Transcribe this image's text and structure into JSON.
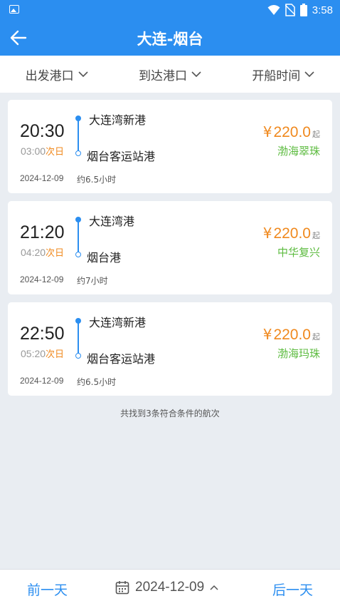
{
  "status_bar": {
    "time": "3:58"
  },
  "header": {
    "title": "大连-烟台"
  },
  "filters": [
    {
      "label": "出发港口"
    },
    {
      "label": "到达港口"
    },
    {
      "label": "开船时间"
    }
  ],
  "voyages": [
    {
      "departure_time": "20:30",
      "arrival_time": "03:00",
      "arrival_day_note": "次日",
      "departure_port": "大连湾新港",
      "arrival_port": "烟台客运站港",
      "price_symbol": "¥",
      "price": "220.0",
      "price_unit": "起",
      "ship_name": "渤海翠珠",
      "date": "2024-12-09",
      "duration": "约6.5小时"
    },
    {
      "departure_time": "21:20",
      "arrival_time": "04:20",
      "arrival_day_note": "次日",
      "departure_port": "大连湾港",
      "arrival_port": "烟台港",
      "price_symbol": "¥",
      "price": "220.0",
      "price_unit": "起",
      "ship_name": "中华复兴",
      "date": "2024-12-09",
      "duration": "约7小时"
    },
    {
      "departure_time": "22:50",
      "arrival_time": "05:20",
      "arrival_day_note": "次日",
      "departure_port": "大连湾新港",
      "arrival_port": "烟台客运站港",
      "price_symbol": "¥",
      "price": "220.0",
      "price_unit": "起",
      "ship_name": "渤海玛珠",
      "date": "2024-12-09",
      "duration": "约6.5小时"
    }
  ],
  "result_summary": "共找到3条符合条件的航次",
  "bottom_bar": {
    "prev_label": "前一天",
    "date": "2024-12-09",
    "next_label": "后一天"
  },
  "colors": {
    "primary": "#2b8ef0",
    "price": "#f0891e",
    "ship": "#5cbb3f",
    "background": "#e9edf2"
  },
  "icons": {
    "status_left": "image-icon",
    "status_right": [
      "wifi-icon",
      "no-sim-icon",
      "battery-icon"
    ],
    "back": "arrow-left-icon",
    "filter": "chevron-down-icon",
    "calendar": "calendar-icon",
    "date_toggle": "chevron-up-icon"
  }
}
